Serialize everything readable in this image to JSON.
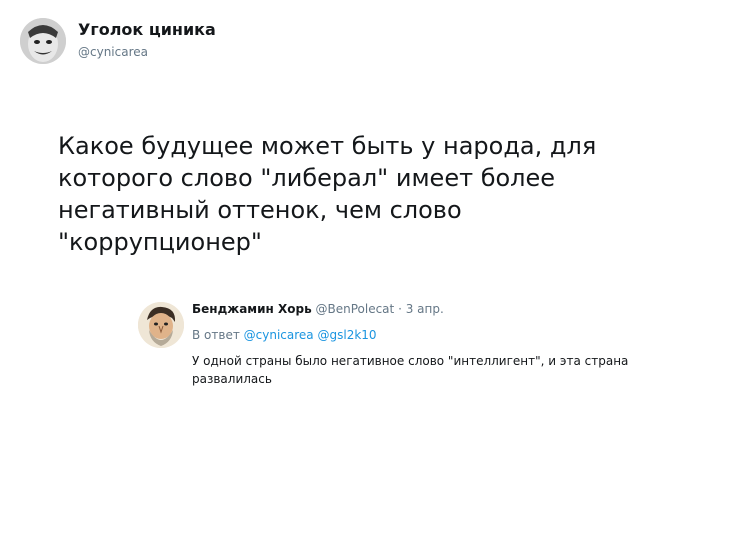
{
  "tweet": {
    "author_name": "Уголок циника",
    "author_handle": "@cynicarea",
    "text": "Какое будущее может быть у народа, для которого слово \"либерал\" имеет более негативный оттенок, чем слово \"коррупционер\""
  },
  "reply": {
    "author_name": "Бенджамин Хорь",
    "author_handle": "@BenPolecat",
    "separator": "·",
    "date": "3 апр.",
    "reply_prefix": "В ответ",
    "mentions": [
      "@cynicarea",
      "@gsl2k10"
    ],
    "text": "У одной страны было негативное слово \"интеллигент\", и эта страна развалилась"
  },
  "colors": {
    "text": "#14171a",
    "secondary": "#657786",
    "link": "#1b95e0",
    "background": "#ffffff"
  }
}
